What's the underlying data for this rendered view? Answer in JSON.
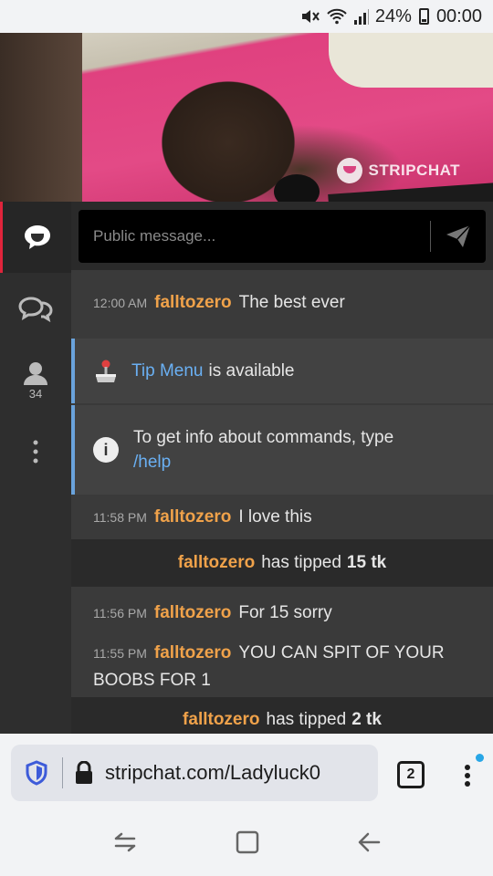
{
  "status_bar": {
    "battery": "24%",
    "time": "00:00"
  },
  "video": {
    "watermark": "STRIPCHAT"
  },
  "sidebar": {
    "viewer_count": "34"
  },
  "composer": {
    "placeholder": "Public message..."
  },
  "messages": [
    {
      "time": "12:00 AM",
      "user": "falltozero",
      "text": "The best ever"
    },
    {
      "time": "11:58 PM",
      "user": "falltozero",
      "text": "I love this"
    },
    {
      "time": "11:56 PM",
      "user": "falltozero",
      "text": "For 15 sorry"
    },
    {
      "time": "11:55 PM",
      "user": "falltozero",
      "text": "YOU CAN SPIT OF YOUR BOOBS FOR 1"
    }
  ],
  "notices": {
    "tip_menu_link": "Tip Menu",
    "tip_menu_rest": "is available",
    "commands_text": "To get info about commands, type",
    "commands_link": "/help"
  },
  "tips": [
    {
      "user": "falltozero",
      "text": "has tipped",
      "amount": "15 tk"
    },
    {
      "user": "falltozero",
      "text": "has tipped",
      "amount": "2 tk"
    }
  ],
  "browser": {
    "url": "stripchat.com/Ladyluck0",
    "tab_count": "2",
    "accent_color": "#28a6e6"
  }
}
